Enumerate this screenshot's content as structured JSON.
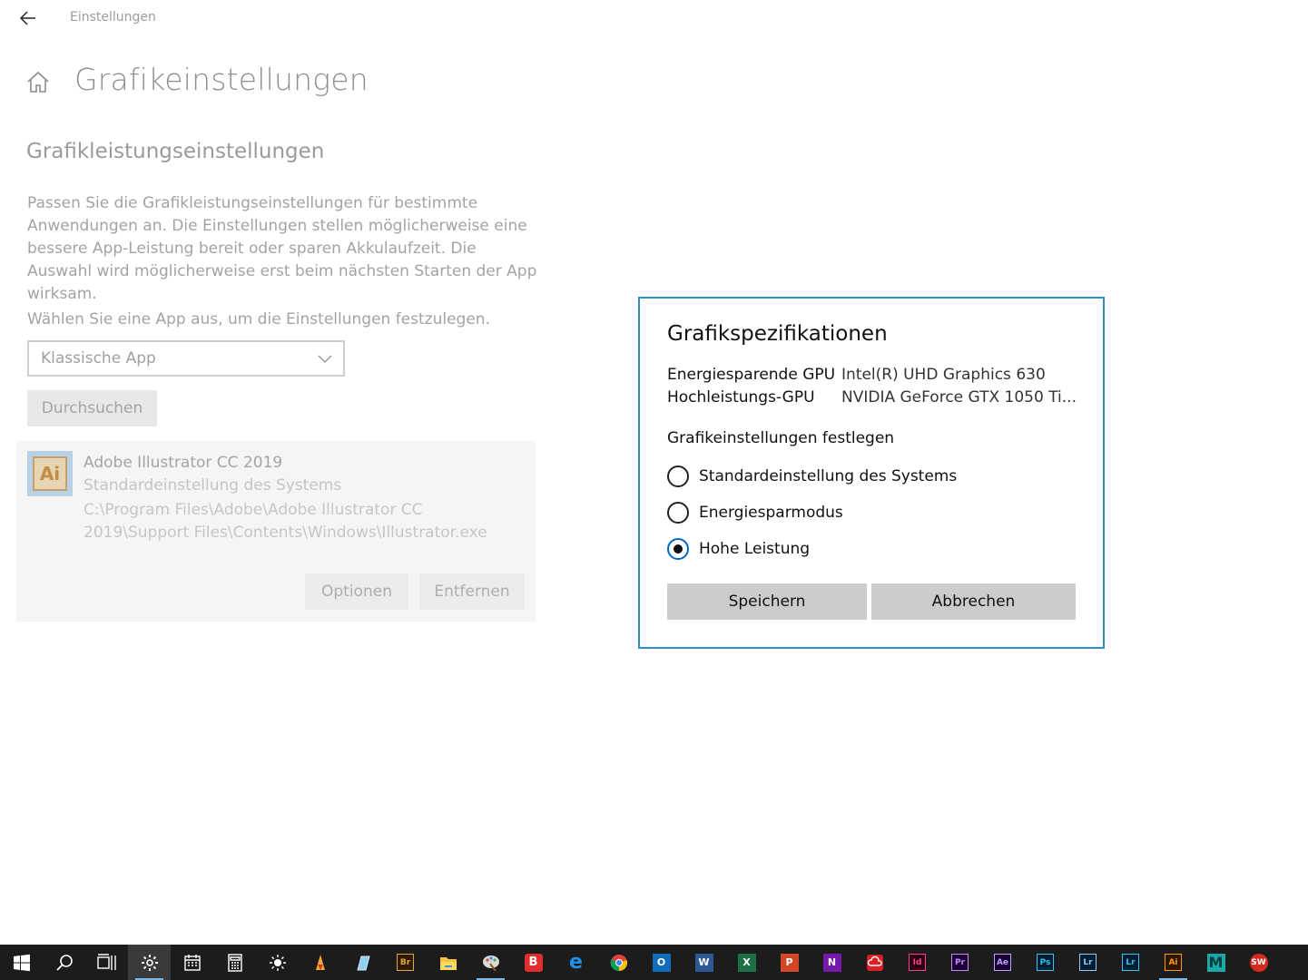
{
  "window": {
    "title": "Einstellungen"
  },
  "page": {
    "title": "Grafikeinstellungen"
  },
  "section": {
    "title": "Grafikleistungseinstellungen",
    "description": "Passen Sie die Grafikleistungseinstellungen für bestimmte Anwendungen an. Die Einstellungen stellen möglicherweise eine bessere App-Leistung bereit oder sparen Akkulaufzeit. Die Auswahl wird möglicherweise erst beim nächsten Starten der App wirksam.",
    "select_label": "Wählen Sie eine App aus, um die Einstellungen festzulegen.",
    "select_value": "Klassische App",
    "browse_label": "Durchsuchen"
  },
  "app_entry": {
    "icon_text": "Ai",
    "name": "Adobe Illustrator CC 2019",
    "setting": "Standardeinstellung des Systems",
    "path": "C:\\Program Files\\Adobe\\Adobe Illustrator CC 2019\\Support Files\\Contents\\Windows\\Illustrator.exe",
    "options_label": "Optionen",
    "remove_label": "Entfernen"
  },
  "dialog": {
    "title": "Grafikspezifikationen",
    "gpus": [
      {
        "label": "Energiesparende GPU",
        "value": "Intel(R) UHD Graphics 630"
      },
      {
        "label": "Hochleistungs-GPU",
        "value": "NVIDIA GeForce GTX 1050 Ti..."
      }
    ],
    "subtitle": "Grafikeinstellungen festlegen",
    "options": [
      {
        "label": "Standardeinstellung des Systems",
        "checked": false
      },
      {
        "label": "Energiesparmodus",
        "checked": false
      },
      {
        "label": "Hohe Leistung",
        "checked": true
      }
    ],
    "save_label": "Speichern",
    "cancel_label": "Abbrechen"
  },
  "taskbar": {
    "items": [
      {
        "name": "start-icon"
      },
      {
        "name": "search-icon"
      },
      {
        "name": "task-view-icon"
      },
      {
        "name": "settings-icon",
        "active": true
      },
      {
        "name": "calendar-icon"
      },
      {
        "name": "calculator-icon"
      },
      {
        "name": "brightness-icon"
      },
      {
        "name": "pencil-icon"
      },
      {
        "name": "notepad-icon"
      },
      {
        "name": "bridge-icon",
        "text": "Br"
      },
      {
        "name": "explorer-icon"
      },
      {
        "name": "paint-icon"
      },
      {
        "name": "b-app-icon",
        "text": "B"
      },
      {
        "name": "edge-icon",
        "text": "e"
      },
      {
        "name": "chrome-icon"
      },
      {
        "name": "outlook-icon",
        "text": "O"
      },
      {
        "name": "word-icon",
        "text": "W"
      },
      {
        "name": "excel-icon",
        "text": "X"
      },
      {
        "name": "powerpoint-icon",
        "text": "P"
      },
      {
        "name": "onenote-icon",
        "text": "N"
      },
      {
        "name": "creative-cloud-icon"
      },
      {
        "name": "indesign-icon",
        "text": "Id"
      },
      {
        "name": "premiere-icon",
        "text": "Pr"
      },
      {
        "name": "after-effects-icon",
        "text": "Ae"
      },
      {
        "name": "photoshop-icon",
        "text": "Ps"
      },
      {
        "name": "lightroom-classic-icon",
        "text": "Lr"
      },
      {
        "name": "lightroom-icon",
        "text": "Lr"
      },
      {
        "name": "illustrator-icon",
        "text": "Ai",
        "running": true
      },
      {
        "name": "maya-icon",
        "text": "M"
      },
      {
        "name": "solidworks-icon",
        "text": "SW"
      }
    ]
  },
  "colors": {
    "accent": "#0067c0",
    "dialog_border": "#2f8fc6",
    "taskbar": "#1c1c1c"
  }
}
